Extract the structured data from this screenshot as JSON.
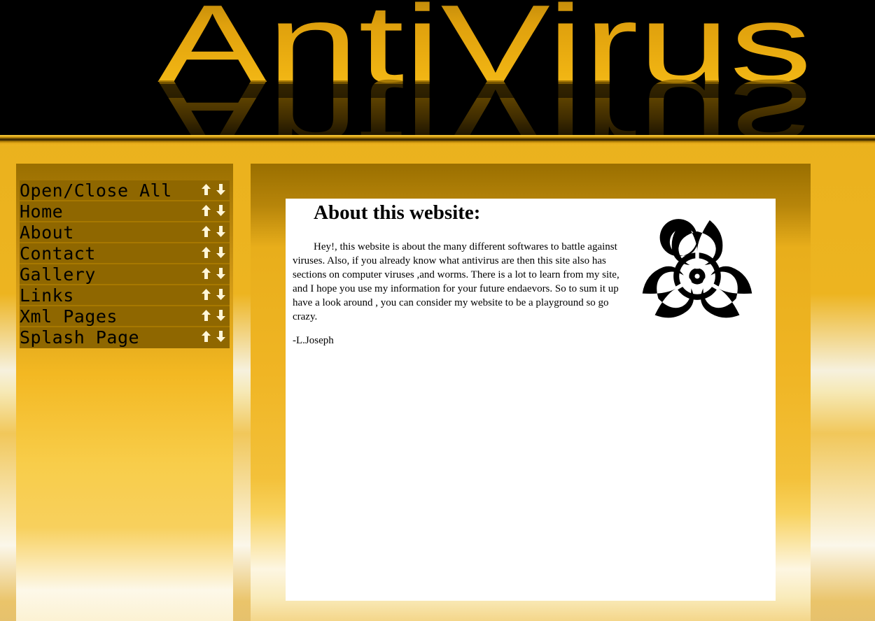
{
  "header": {
    "logo_text": "AntiVirus",
    "logo_gold": "#e8a90f",
    "background": "#000000"
  },
  "sidebar": {
    "items": [
      {
        "label": "Open/Close All"
      },
      {
        "label": "Home"
      },
      {
        "label": "About"
      },
      {
        "label": "Contact"
      },
      {
        "label": "Gallery"
      },
      {
        "label": "Links"
      },
      {
        "label": "Xml Pages"
      },
      {
        "label": "Splash Page"
      }
    ],
    "item_icons": [
      "arrow-up-icon",
      "arrow-down-icon"
    ]
  },
  "content": {
    "title": "About this website:",
    "paragraph": "Hey!, this website is about the many different softwares to battle against viruses. Also, if you already know what antivirus are then this site also has sections on computer viruses ,and worms. There is a lot to learn from my site, and I hope you use my information for your future endaevors. So to sum it up have a look around , you can consider my website to be a playground so go crazy.",
    "signature": "-L.Joseph",
    "image_icon": "biohazard-icon"
  },
  "colors": {
    "accent_gold": "#edb420",
    "menu_brown": "#8f6700"
  }
}
